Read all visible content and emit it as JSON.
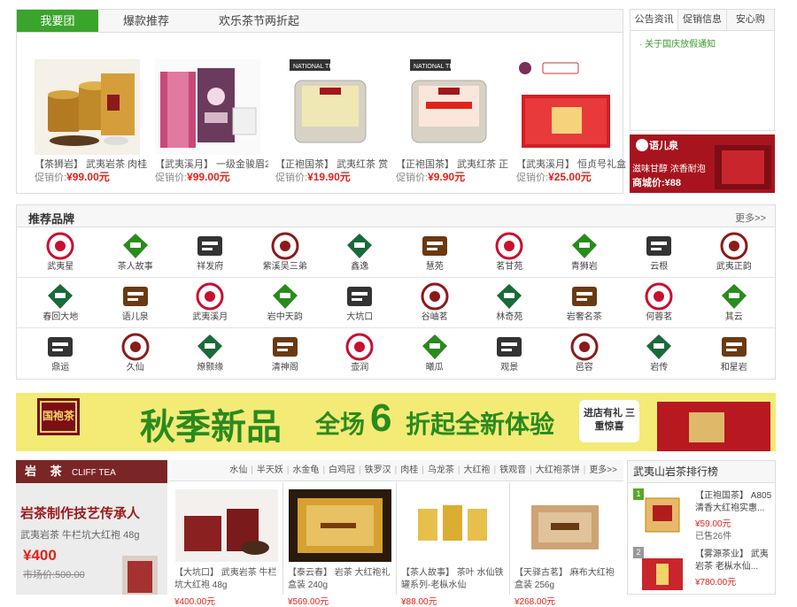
{
  "groupbuy": {
    "tabs": [
      "我要团",
      "爆款推荐",
      "欢乐茶节两折起"
    ],
    "products": [
      {
        "title": "【茶狮岩】 武夷岩茶 肉桂",
        "price_label": "促销价:",
        "price": "¥99.00元"
      },
      {
        "title": "【武夷溪月】 一级金骏眉2",
        "price_label": "促销价:",
        "price": "¥99.00元"
      },
      {
        "title": "【正袍国茶】 武夷红茶 赏",
        "price_label": "促销价:",
        "price": "¥19.90元"
      },
      {
        "title": "【正袍国茶】 武夷红茶 正",
        "price_label": "促销价:",
        "price": "¥9.90元"
      },
      {
        "title": "【武夷溪月】 恒贞号礼盒",
        "price_label": "促销价:",
        "price": "¥25.00元"
      }
    ]
  },
  "notice": {
    "tabs": [
      "公告资讯",
      "促销信息",
      "安心购"
    ],
    "items": [
      "· 关于国庆放假通知"
    ]
  },
  "side_ad": {
    "brand": "语儿泉",
    "line1": "滋味甘醇 浓香耐泡",
    "price": "商城价:¥88"
  },
  "brands": {
    "title": "推荐品牌",
    "more": "更多>>",
    "rows": [
      [
        "武夷星",
        "茶人故事",
        "祥发府",
        "紫溪吴三弟",
        "鑫逸",
        "慧苑",
        "茗甘苑",
        "青狮岩",
        "云根",
        "武夷正韵"
      ],
      [
        "春回大地",
        "语儿泉",
        "武夷溪月",
        "岩中天韵",
        "大坑口",
        "谷岫茗",
        "林奇苑",
        "岩奢名茶",
        "何蓉茗",
        "其云"
      ],
      [
        "鼎运",
        "久仙",
        "燎颢缘",
        "清神阁",
        "壶润",
        "曦瓜",
        "观景",
        "邑容",
        "岩传",
        "和星岩"
      ]
    ]
  },
  "banner": {
    "logo": "国袍茶",
    "text1": "秋季新品",
    "text2": "全场",
    "num": "6",
    "text3": "折起全新体验",
    "badge": "进店有礼 三重惊喜"
  },
  "cliff": {
    "title_cn": "岩 茶",
    "title_en": "CLIFF TEA",
    "headline": "岩茶制作技艺传承人",
    "subline": "武夷岩茶 牛栏坑大红袍 48g",
    "price": "¥400",
    "market_label": "市场价:",
    "market_price": "500.00"
  },
  "keywords": [
    "水仙",
    "半天妖",
    "水金龟",
    "白鸡冠",
    "铁罗汉",
    "肉桂",
    "乌龙茶",
    "大红袍",
    "铁观音",
    "大红袍茶饼",
    "更多>>"
  ],
  "cliff_products": [
    {
      "title": "【大坑口】 武夷岩茶 牛栏坑大红袍 48g",
      "price": "¥400.00元"
    },
    {
      "title": "【泰云春】 岩茶 大红袍礼盒装 240g",
      "price": "¥569.00元"
    },
    {
      "title": "【茶人故事】 茶叶 水仙铁罐系列-老枞水仙",
      "price": "¥88.00元"
    },
    {
      "title": "【天驿古茗】 麻布大红袍盒装 256g",
      "price": "¥268.00元"
    }
  ],
  "ranking": {
    "title": "武夷山岩茶排行榜",
    "items": [
      {
        "num": "1",
        "title": "【正袍国茶】 A805清香大红袍实惠...",
        "price": "¥59.00元",
        "sold": "已售26件"
      },
      {
        "num": "2",
        "title": "【雾源茶业】 武夷岩茶 老枞水仙...",
        "price": "¥780.00元",
        "sold": ""
      }
    ]
  },
  "colors": {
    "green": "#3aa52b",
    "red": "#e2231a",
    "maroon": "#7b2626",
    "banner": "#f3eb76"
  }
}
